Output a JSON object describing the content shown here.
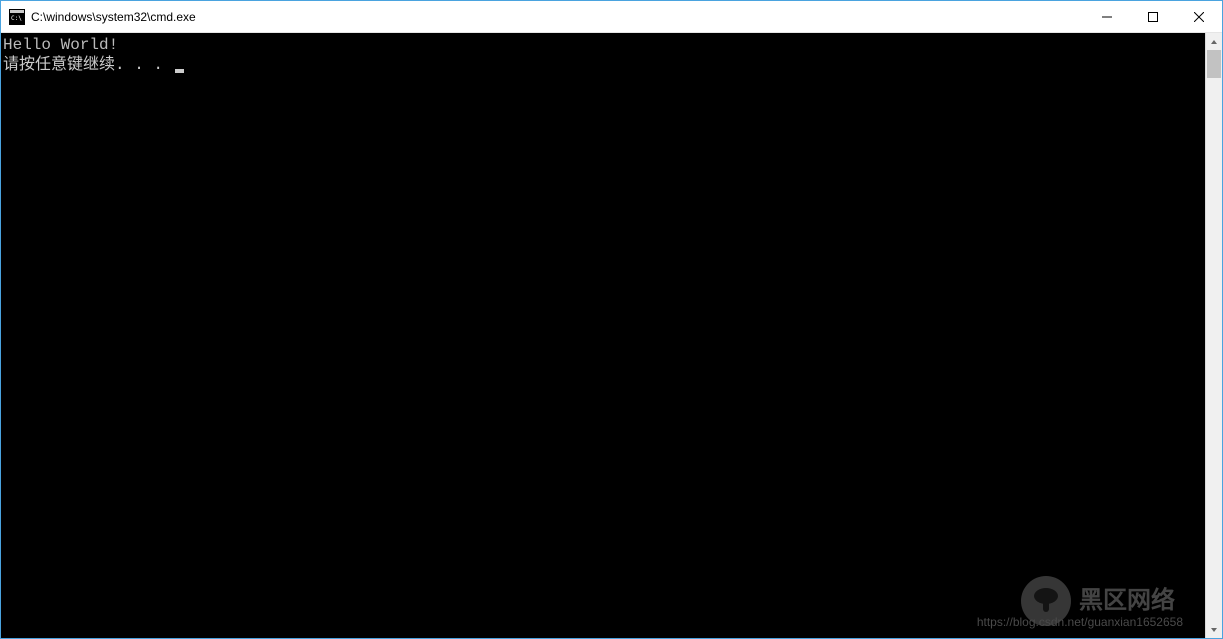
{
  "window": {
    "title": "C:\\windows\\system32\\cmd.exe"
  },
  "terminal": {
    "lines": [
      "Hello World!",
      "请按任意键继续. . . "
    ]
  },
  "watermark": {
    "url": "https://blog.csdn.net/guanxian1652658",
    "brand": "黑区网络"
  }
}
